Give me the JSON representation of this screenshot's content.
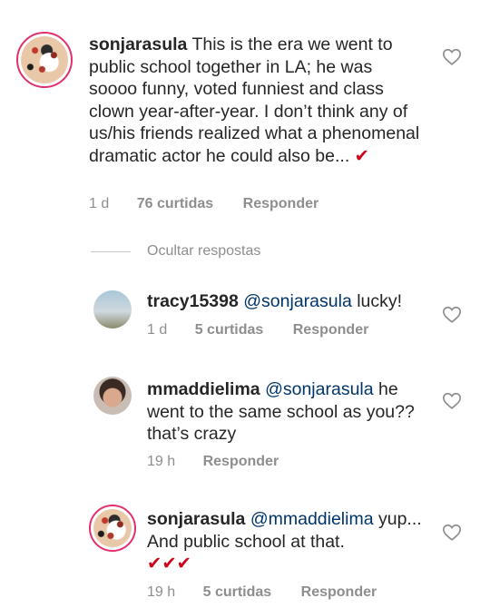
{
  "comments": [
    {
      "username": "sonjarasula",
      "text": "This is the era we went to public school together in LA; he was soooo funny, voted funniest and class clown year-after-year. I don’t think any of us/his friends realized what a phenomenal dramatic actor he could also be...",
      "checks": "✔",
      "time": "1 d",
      "likes": "76 curtidas",
      "reply": "Responder"
    }
  ],
  "hide_replies_label": "Ocultar respostas",
  "replies": [
    {
      "username": "tracy15398",
      "mention": "@sonjarasula",
      "text": " lucky!",
      "time": "1 d",
      "likes": "5 curtidas",
      "reply": "Responder"
    },
    {
      "username": "mmaddielima",
      "mention": "@sonjarasula",
      "text": "he went to the same school as you?? that’s crazy",
      "time": "19 h",
      "reply": "Responder"
    },
    {
      "username": "sonjarasula",
      "mention": "@mmaddielima",
      "text": "yup... And public school at that.",
      "checks": "✔✔✔",
      "time": "19 h",
      "likes": "5 curtidas",
      "reply": "Responder"
    }
  ],
  "icons": {
    "like": "heart-outline-icon"
  },
  "colors": {
    "mention": "#003569",
    "check": "#d0021b",
    "meta": "#8e8e8e"
  }
}
